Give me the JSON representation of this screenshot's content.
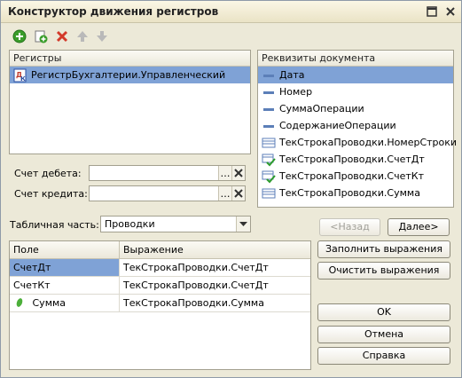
{
  "window": {
    "title": "Конструктор движения регистров"
  },
  "registers": {
    "header": "Регистры",
    "items": [
      {
        "label": "РегистрБухгалтерии.Управленческий",
        "icon": "accounting-register-icon",
        "selected": true
      }
    ]
  },
  "requisites": {
    "header": "Реквизиты документа",
    "items": [
      {
        "label": "Дата",
        "icon": "attribute-icon",
        "selected": true
      },
      {
        "label": "Номер",
        "icon": "attribute-icon"
      },
      {
        "label": "СуммаОперации",
        "icon": "attribute-icon"
      },
      {
        "label": "СодержаниеОперации",
        "icon": "attribute-icon"
      },
      {
        "label": "ТекСтрокаПроводки.НомерСтроки",
        "icon": "table-field-icon"
      },
      {
        "label": "ТекСтрокаПроводки.СчетДт",
        "icon": "table-field-check-icon"
      },
      {
        "label": "ТекСтрокаПроводки.СчетКт",
        "icon": "table-field-check-icon"
      },
      {
        "label": "ТекСтрокаПроводки.Сумма",
        "icon": "table-field-icon"
      }
    ]
  },
  "form": {
    "debit_label": "Счет дебета:",
    "debit_value": "",
    "credit_label": "Счет кредита:",
    "credit_value": "",
    "tabular_label": "Табличная часть:",
    "tabular_value": "Проводки"
  },
  "grid": {
    "columns": [
      "Поле",
      "Выражение"
    ],
    "rows": [
      {
        "field": "СчетДт",
        "expression": "ТекСтрокаПроводки.СчетДт",
        "selected": true
      },
      {
        "field": "СчетКт",
        "expression": "ТекСтрокаПроводки.СчетДт"
      },
      {
        "field": "Сумма",
        "expression": "ТекСтрокаПроводки.Сумма",
        "icon": "resource-icon"
      }
    ]
  },
  "buttons": {
    "back": "<Назад",
    "next": "Далее>",
    "fill": "Заполнить выражения",
    "clear": "Очистить выражения",
    "ok": "OK",
    "cancel": "Отмена",
    "help": "Справка"
  },
  "colors": {
    "selection": "#7fa2d6",
    "window_bg": "#ece9d8",
    "add_green": "#3a9d2a",
    "delete_red": "#d33a2a"
  }
}
